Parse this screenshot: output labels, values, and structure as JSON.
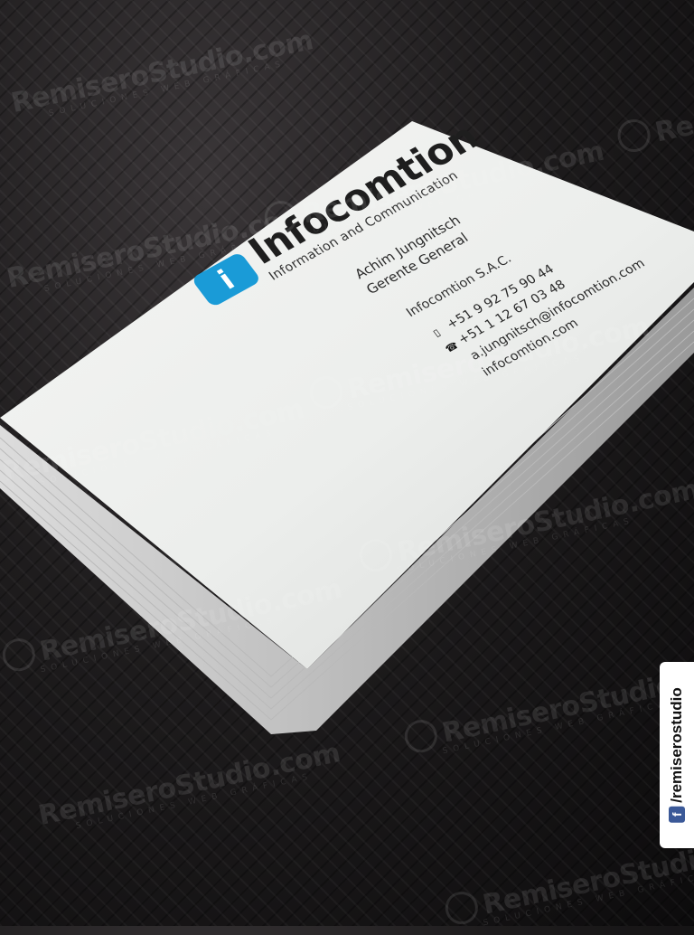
{
  "card": {
    "brand_name": "Infocomtion",
    "brand_logo_letter": "i",
    "tagline": "Information and Communication",
    "person_name": "Achim Jungnitsch",
    "person_title": "Gerente General",
    "company": "Infocomtion S.A.C.",
    "mobile": "+51 9 92 75 90 44",
    "phone": "+51 1 12 67 03 48",
    "email": "a.jungnitsch@infocomtion.com",
    "website": "infocomtion.com",
    "mobile_icon": "mobile-phone-icon",
    "phone_icon": "telephone-icon",
    "brand_color": "#1a9bd7"
  },
  "watermark": {
    "main": "RemiseroStudio.com",
    "sub": "SOLUCIONES WEB GRÁFICAS"
  },
  "badge": {
    "icon": "facebook-icon",
    "icon_glyph": "f",
    "handle": "/remiserostudio"
  }
}
